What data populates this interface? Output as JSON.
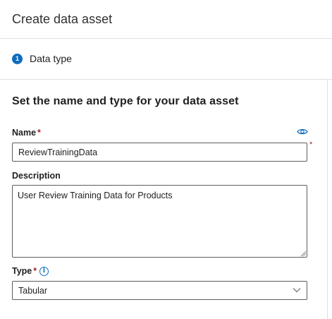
{
  "panel": {
    "title": "Create data asset"
  },
  "steps": [
    {
      "number": "1",
      "label": "Data type"
    }
  ],
  "form": {
    "section_title": "Set the name and type for your data asset",
    "required_marker": "*",
    "name": {
      "label": "Name",
      "value": "ReviewTrainingData",
      "icon": "eye-icon"
    },
    "description": {
      "label": "Description",
      "value": "User Review Training Data for Products"
    },
    "type": {
      "label": "Type",
      "selected": "Tabular",
      "info_icon": "i"
    }
  },
  "colors": {
    "accent": "#0f6cbd",
    "required": "#a4262c",
    "border": "#605e5c",
    "divider": "#e1dfdd"
  }
}
